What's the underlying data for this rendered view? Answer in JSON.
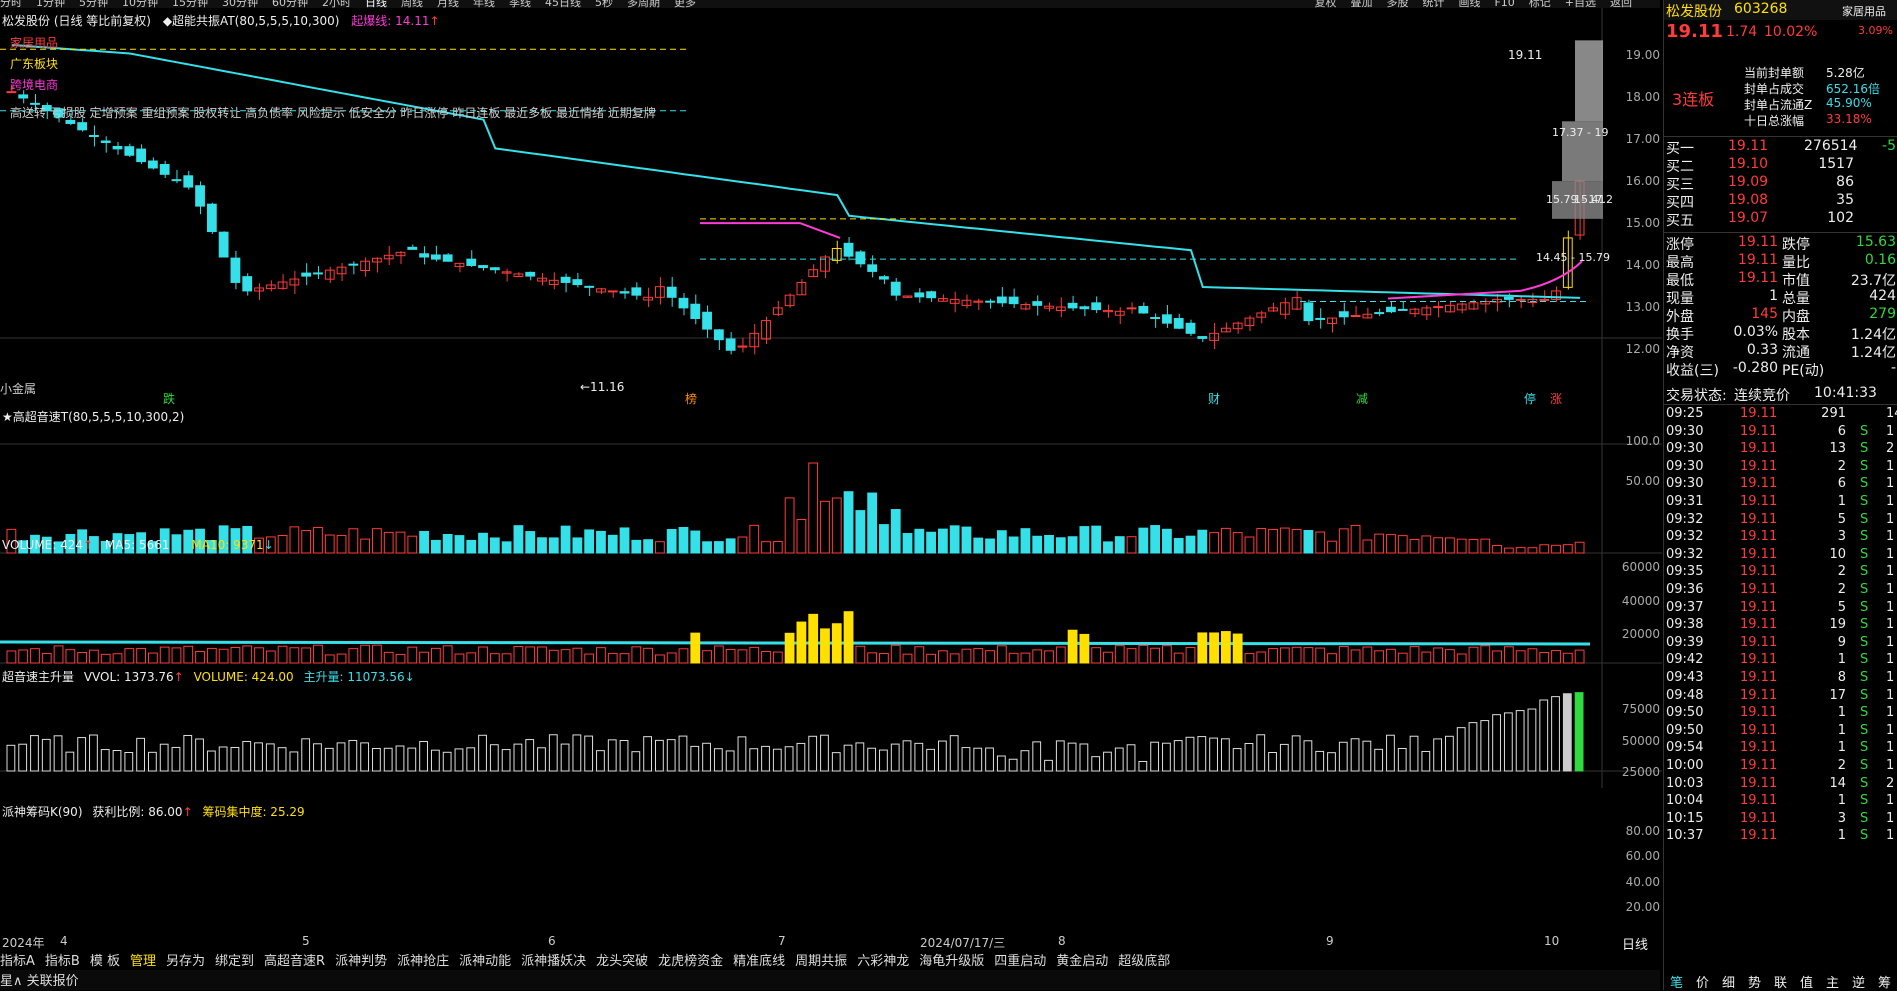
{
  "topbar": {
    "periods": [
      "分时",
      "1分钟",
      "5分钟",
      "10分钟",
      "15分钟",
      "30分钟",
      "60分钟",
      "2小时",
      "日线",
      "周线",
      "月线",
      "年线",
      "季线",
      "45日线",
      "5秒",
      "多周期",
      "更多"
    ],
    "active": "日线",
    "actions": [
      "复权",
      "叠加",
      "多股",
      "统计",
      "画线",
      "F10",
      "标记",
      "+自选",
      "返回"
    ]
  },
  "main": {
    "title": "松发股份 (日线 等比前复权)",
    "indicator": "◆超能共振AT(80,5,5,5,10,300)",
    "limit_label": "起爆线:",
    "limit_value": "14.11",
    "tags": [
      "家居用品",
      "广东板块",
      "跨境电商"
    ],
    "concepts": "高送转 亏损股 定增预案 重组预案 股权转让 高负债率 风险提示 低安全分 昨日涨停 昨日连板 最近多板 最近情绪 近期复牌",
    "price_labels": {
      "high": "19.11",
      "low": "←11.16",
      "box1": "17.37 - 19",
      "box2": "15.79 - 17.2",
      "box3": "15.41",
      "box4": "14.45 - 15.79"
    },
    "bottom_left": "小金属",
    "markers": [
      "跌",
      "榜",
      "财",
      "减",
      "停",
      "涨"
    ],
    "yaxis": [
      "19.00",
      "18.00",
      "17.00",
      "16.00",
      "15.00",
      "14.00",
      "13.00",
      "12.00"
    ]
  },
  "sub1": {
    "title": "★高超音速T(80,5,5,5,10,300,2)",
    "yaxis": [
      "100.0",
      "50.00"
    ]
  },
  "sub2": {
    "label": "VOLUME: 424",
    "ma5": "MA5: 5661",
    "ma10": "MA10: 9371",
    "yaxis": [
      "60000",
      "40000",
      "20000"
    ]
  },
  "sub3": {
    "label": "超音速主升量",
    "vvol": "VVOL: 1373.76",
    "vol": "VOLUME: 424.00",
    "zsl": "主升量: 11073.56",
    "yaxis": [
      "75000",
      "50000",
      "25000"
    ]
  },
  "sub4": {
    "label": "派神筹码K(90)",
    "profit": "获利比例: 86.00",
    "conc": "筹码集中度: 25.29",
    "yaxis": [
      "80.00",
      "60.00",
      "40.00",
      "20.00"
    ]
  },
  "xaxis": [
    "2024年",
    "4",
    "5",
    "6",
    "7",
    "2024/07/17/三",
    "8",
    "9",
    "10"
  ],
  "xaxis_right": "日线",
  "bottombar": [
    "指标A",
    "指标B",
    "模 板",
    "管理",
    "另存为",
    "绑定到",
    "高超音速R",
    "派神判势",
    "派神抢庄",
    "派神动能",
    "派神播妖决",
    "龙头突破",
    "龙虎榜资金",
    "精准底线",
    "周期共振",
    "六彩神龙",
    "海龟升级版",
    "四重启动",
    "黄金启动",
    "超级底部"
  ],
  "bottombar_active": "管理",
  "statusbar": "星∧ 关联报价",
  "right": {
    "name": "松发股份",
    "code": "603268",
    "sector": "家居用品",
    "price": "19.11",
    "change": "1.74",
    "pct": "10.02%",
    "pct2": "3.09%",
    "lianban": "3连板",
    "seal": [
      {
        "k": "当前封单额",
        "v": "5.28亿"
      },
      {
        "k": "封单占成交",
        "v": "652.16倍"
      },
      {
        "k": "封单占流通Z",
        "v": "45.90%"
      },
      {
        "k": "十日总涨幅",
        "v": "33.18%"
      }
    ],
    "bids": [
      {
        "k": "买一",
        "p": "19.11",
        "v": "276514",
        "d": "-5"
      },
      {
        "k": "买二",
        "p": "19.10",
        "v": "1517",
        "d": ""
      },
      {
        "k": "买三",
        "p": "19.09",
        "v": "86",
        "d": ""
      },
      {
        "k": "买四",
        "p": "19.08",
        "v": "35",
        "d": ""
      },
      {
        "k": "买五",
        "p": "19.07",
        "v": "102",
        "d": ""
      }
    ],
    "stats": [
      {
        "a": "涨停",
        "b": "19.11",
        "c": "跌停",
        "d": "15.63"
      },
      {
        "a": "最高",
        "b": "19.11",
        "c": "量比",
        "d": "0.16"
      },
      {
        "a": "最低",
        "b": "19.11",
        "c": "市值",
        "d": "23.7亿"
      },
      {
        "a": "现量",
        "b": "1",
        "c": "总量",
        "d": "424"
      },
      {
        "a": "外盘",
        "b": "145",
        "c": "内盘",
        "d": "279"
      },
      {
        "a": "换手",
        "b": "0.03%",
        "c": "股本",
        "d": "1.24亿"
      },
      {
        "a": "净资",
        "b": "0.33",
        "c": "流通",
        "d": "1.24亿"
      },
      {
        "a": "收益(三)",
        "b": "-0.280",
        "c": "PE(动)",
        "d": "-"
      }
    ],
    "trade_state_label": "交易状态:",
    "trade_state": "连续竞价",
    "time": "10:41:33",
    "ticks": [
      [
        "09:25",
        "19.11",
        "291",
        "",
        "14"
      ],
      [
        "09:30",
        "19.11",
        "6",
        "S",
        "1"
      ],
      [
        "09:30",
        "19.11",
        "13",
        "S",
        "2"
      ],
      [
        "09:30",
        "19.11",
        "2",
        "S",
        "1"
      ],
      [
        "09:30",
        "19.11",
        "6",
        "S",
        "1"
      ],
      [
        "09:31",
        "19.11",
        "1",
        "S",
        "1"
      ],
      [
        "09:32",
        "19.11",
        "5",
        "S",
        "1"
      ],
      [
        "09:32",
        "19.11",
        "3",
        "S",
        "1"
      ],
      [
        "09:32",
        "19.11",
        "10",
        "S",
        "1"
      ],
      [
        "09:35",
        "19.11",
        "2",
        "S",
        "1"
      ],
      [
        "09:36",
        "19.11",
        "2",
        "S",
        "1"
      ],
      [
        "09:37",
        "19.11",
        "5",
        "S",
        "1"
      ],
      [
        "09:38",
        "19.11",
        "19",
        "S",
        "1"
      ],
      [
        "09:39",
        "19.11",
        "9",
        "S",
        "1"
      ],
      [
        "09:42",
        "19.11",
        "1",
        "S",
        "1"
      ],
      [
        "09:43",
        "19.11",
        "8",
        "S",
        "1"
      ],
      [
        "09:48",
        "19.11",
        "17",
        "S",
        "1"
      ],
      [
        "09:50",
        "19.11",
        "1",
        "S",
        "1"
      ],
      [
        "09:50",
        "19.11",
        "1",
        "S",
        "1"
      ],
      [
        "09:54",
        "19.11",
        "1",
        "S",
        "1"
      ],
      [
        "10:00",
        "19.11",
        "2",
        "S",
        "1"
      ],
      [
        "10:03",
        "19.11",
        "14",
        "S",
        "2"
      ],
      [
        "10:04",
        "19.11",
        "1",
        "S",
        "1"
      ],
      [
        "10:15",
        "19.11",
        "3",
        "S",
        "1"
      ],
      [
        "10:37",
        "19.11",
        "1",
        "S",
        "1"
      ]
    ],
    "tabs": [
      "笔",
      "价",
      "细",
      "势",
      "联",
      "值",
      "主",
      "逆",
      "筹"
    ]
  },
  "colors": {
    "up": "#ff3b3b",
    "down": "#35e0e8",
    "ma": "#35e0e8",
    "ma_up": "#ff3bd8",
    "limit": "#ffe000",
    "bg": "#000000"
  }
}
